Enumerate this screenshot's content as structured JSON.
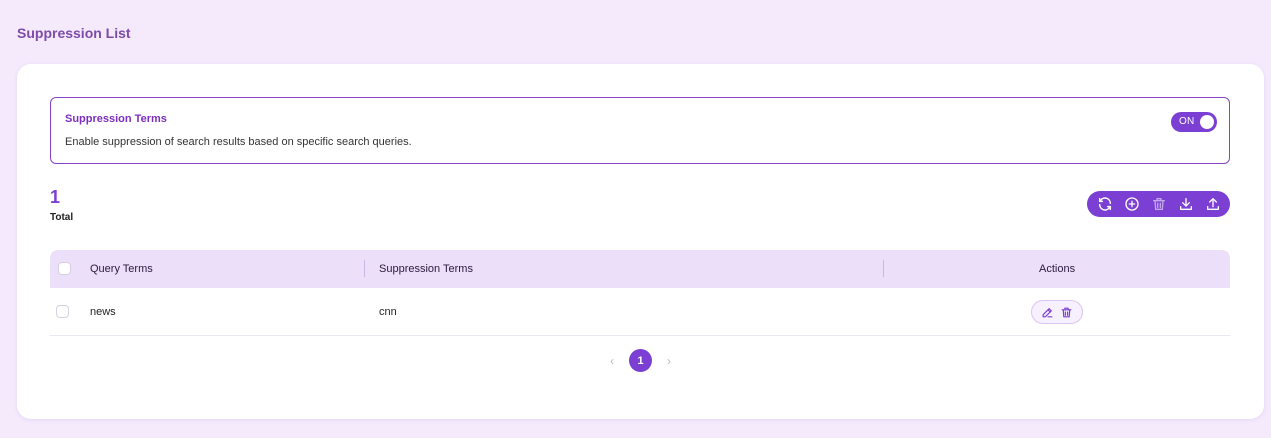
{
  "page": {
    "title": "Suppression List"
  },
  "setting": {
    "title": "Suppression Terms",
    "description": "Enable suppression of search results based on specific search queries.",
    "toggle_label": "ON"
  },
  "summary": {
    "count": "1",
    "label": "Total"
  },
  "toolbar": {
    "icons": [
      "refresh-icon",
      "add-circle-icon",
      "delete-icon",
      "download-icon",
      "upload-icon"
    ]
  },
  "table": {
    "columns": [
      "Query Terms",
      "Suppression Terms",
      "Actions"
    ],
    "rows": [
      {
        "query": "news",
        "suppression": "cnn"
      }
    ]
  },
  "pagination": {
    "current": "1",
    "prev": "‹",
    "next": "›"
  },
  "colors": {
    "accent": "#7b3fd4",
    "background": "#f4eafc",
    "header": "#ecdffa"
  }
}
